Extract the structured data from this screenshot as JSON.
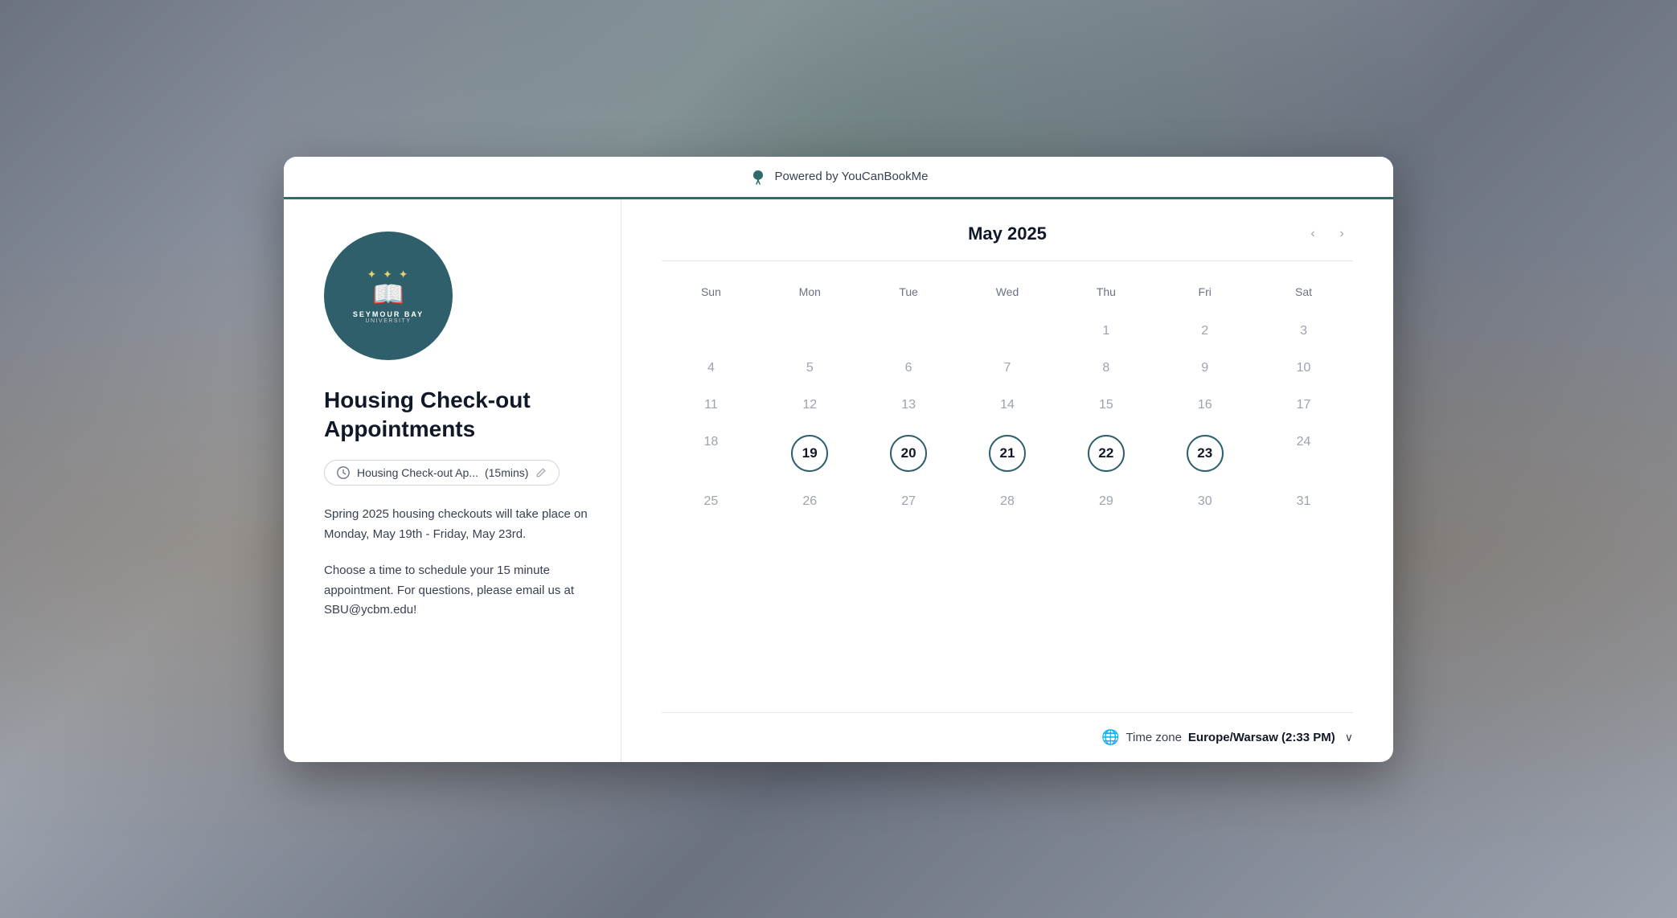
{
  "header": {
    "powered_by": "Powered by YouCanBookMe"
  },
  "left": {
    "org_name": "SEYMOUR BAY",
    "org_sub": "UNIVERSITY",
    "title": "Housing Check-out Appointments",
    "badge": {
      "label": "Housing Check-out Ap...",
      "duration": "(15mins)"
    },
    "description_1": "Spring 2025 housing checkouts will take place on Monday, May 19th - Friday, May 23rd.",
    "description_2": "Choose a time to schedule your 15 minute appointment. For questions, please email us at SBU@ycbm.edu!"
  },
  "calendar": {
    "title": "May 2025",
    "days_of_week": [
      "Sun",
      "Mon",
      "Tue",
      "Wed",
      "Thu",
      "Fri",
      "Sat"
    ],
    "prev_label": "‹",
    "next_label": "›",
    "weeks": [
      [
        null,
        null,
        null,
        null,
        "1",
        "2",
        "3"
      ],
      [
        "4",
        "5",
        "6",
        "7",
        "8",
        "9",
        "10"
      ],
      [
        "11",
        "12",
        "13",
        "14",
        "15",
        "16",
        "17"
      ],
      [
        "18",
        "19",
        "20",
        "21",
        "22",
        "23",
        "24"
      ],
      [
        "25",
        "26",
        "27",
        "28",
        "29",
        "30",
        "31"
      ]
    ],
    "available_dates": [
      "19",
      "20",
      "21",
      "22",
      "23"
    ]
  },
  "footer": {
    "timezone_label": "Time zone",
    "timezone_value": "Europe/Warsaw (2:33 PM)",
    "dropdown_arrow": "∨"
  }
}
